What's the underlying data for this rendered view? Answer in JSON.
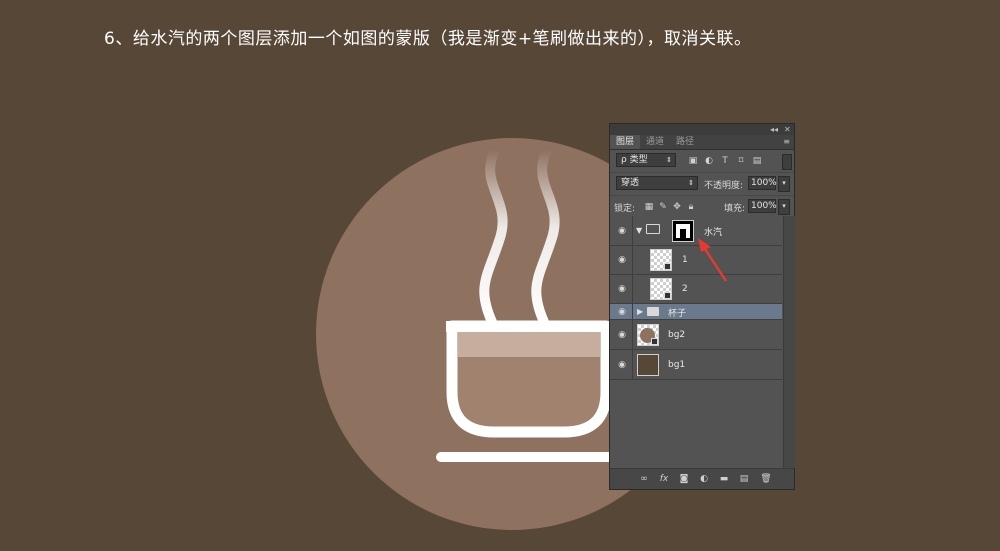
{
  "caption": "6、给水汽的两个图层添加一个如图的蒙版（我是渐变+笔刷做出来的），取消关联。",
  "colors": {
    "background": "#574737",
    "circle": "#8f715f",
    "cup_fill": "#a1826f",
    "cup_stroke": "#ffffff",
    "steam": "#ffffff",
    "arrow": "#e53a2f",
    "selected_row": "#6a7a8c"
  },
  "panel": {
    "top_controls": {
      "collapse": "◂◂",
      "close": "✕"
    },
    "tabs": [
      {
        "label": "图层",
        "active": true
      },
      {
        "label": "通道",
        "active": false
      },
      {
        "label": "路径",
        "active": false
      }
    ],
    "menu_icon": "≡",
    "filter": {
      "label": "ρ 类型",
      "icons": [
        "image-filter-icon",
        "adjustment-filter-icon",
        "type-filter-icon",
        "shape-filter-icon",
        "smart-object-filter-icon"
      ]
    },
    "blend_mode": "穿透",
    "opacity_label": "不透明度:",
    "opacity_value": "100%",
    "lock_label": "锁定:",
    "fill_label": "填充:",
    "fill_value": "100%",
    "layers": [
      {
        "name": "水汽",
        "type": "group",
        "expanded": true,
        "has_mask": true,
        "selected": false
      },
      {
        "name": "1",
        "type": "smart-object",
        "indent": true,
        "selected": false
      },
      {
        "name": "2",
        "type": "smart-object",
        "indent": true,
        "selected": false
      },
      {
        "name": "杯子",
        "type": "group",
        "expanded": false,
        "selected": true
      },
      {
        "name": "bg2",
        "type": "smart-object",
        "selected": false
      },
      {
        "name": "bg1",
        "type": "layer",
        "selected": false
      }
    ],
    "bottom_icons": [
      "link-icon",
      "fx-icon",
      "mask-icon",
      "adjustment-icon",
      "folder-icon",
      "new-layer-icon",
      "trash-icon"
    ]
  }
}
